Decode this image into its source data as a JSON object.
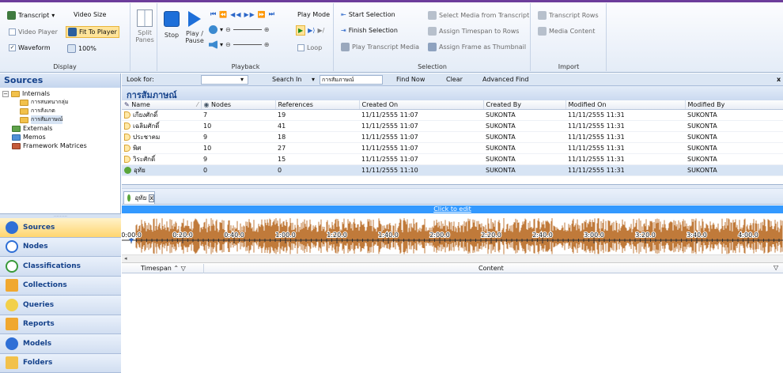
{
  "ribbon": {
    "document_group": {
      "transcript": "Transcript",
      "video_size": "Video Size",
      "video_player": "Video Player",
      "fit_to_player": "Fit To Player",
      "waveform": "Waveform",
      "zoom": "100%",
      "label": "Display"
    },
    "panes": {
      "split": "Split",
      "panes": "Panes"
    },
    "playback": {
      "stop": "Stop",
      "play_pause_1": "Play /",
      "play_pause_2": "Pause",
      "play_mode": "Play Mode",
      "loop": "Loop",
      "label": "Playback"
    },
    "selection": {
      "start_selection": "Start Selection",
      "finish_selection": "Finish Selection",
      "play_transcript_media": "Play Transcript Media",
      "select_media": "Select Media from Transcript",
      "assign_timespan": "Assign Timespan to Rows",
      "assign_frame": "Assign Frame as Thumbnail",
      "label": "Selection"
    },
    "import": {
      "transcript_rows": "Transcript Rows",
      "media_content": "Media Content",
      "label": "Import"
    }
  },
  "sidebar": {
    "title": "Sources",
    "tree": {
      "internals": "Internals",
      "child1": "การสนทนากลุ่ม",
      "child2": "การสังเกต",
      "child3": "การสัมภาษณ์",
      "externals": "Externals",
      "memos": "Memos",
      "framework": "Framework Matrices"
    },
    "nav": [
      "Sources",
      "Nodes",
      "Classifications",
      "Collections",
      "Queries",
      "Reports",
      "Models",
      "Folders"
    ],
    "splitter_dots": "........."
  },
  "search": {
    "look_for": "Look for:",
    "search_in": "Search In",
    "search_in_value": "การสัมภาษณ์",
    "find_now": "Find Now",
    "clear": "Clear",
    "advanced_find": "Advanced Find",
    "close": "x"
  },
  "list": {
    "title": "การสัมภาษณ์",
    "columns": [
      "Name",
      "Nodes",
      "References",
      "Created On",
      "Created By",
      "Modified On",
      "Modified By"
    ],
    "rows": [
      {
        "name": "เกียงศักดิ์",
        "nodes": "7",
        "refs": "19",
        "created_on": "11/11/2555 11:07",
        "created_by": "SUKONTA",
        "modified_on": "11/11/2555 11:31",
        "modified_by": "SUKONTA"
      },
      {
        "name": "เฉลิมศักดิ์",
        "nodes": "10",
        "refs": "41",
        "created_on": "11/11/2555 11:07",
        "created_by": "SUKONTA",
        "modified_on": "11/11/2555 11:31",
        "modified_by": "SUKONTA"
      },
      {
        "name": "ประชาคม",
        "nodes": "9",
        "refs": "18",
        "created_on": "11/11/2555 11:07",
        "created_by": "SUKONTA",
        "modified_on": "11/11/2555 11:31",
        "modified_by": "SUKONTA"
      },
      {
        "name": "พิศ",
        "nodes": "10",
        "refs": "27",
        "created_on": "11/11/2555 11:07",
        "created_by": "SUKONTA",
        "modified_on": "11/11/2555 11:31",
        "modified_by": "SUKONTA"
      },
      {
        "name": "วิระศักดิ์",
        "nodes": "9",
        "refs": "15",
        "created_on": "11/11/2555 11:07",
        "created_by": "SUKONTA",
        "modified_on": "11/11/2555 11:31",
        "modified_by": "SUKONTA"
      },
      {
        "name": "อุทัย",
        "nodes": "0",
        "refs": "0",
        "created_on": "11/11/2555 11:10",
        "created_by": "SUKONTA",
        "modified_on": "11/11/2555 11:31",
        "modified_by": "SUKONTA"
      }
    ]
  },
  "detail": {
    "tab_label": "อุทัย",
    "tab_close": "x",
    "click_to_edit": "Click to edit",
    "time_ticks": [
      "0:00.0",
      "0:20.0",
      "0:40.0",
      "1:00.0",
      "1:20.0",
      "1:40.0",
      "2:00.0",
      "2:20.0",
      "2:40.0",
      "3:00.0",
      "3:20.0",
      "3:40.0",
      "4:00.0"
    ],
    "timespan_col": "Timespan",
    "content_col": "Content"
  },
  "colors": {
    "accent": "#15428b",
    "waveform": "#c07a3a",
    "selection_bar": "#3399ff"
  }
}
